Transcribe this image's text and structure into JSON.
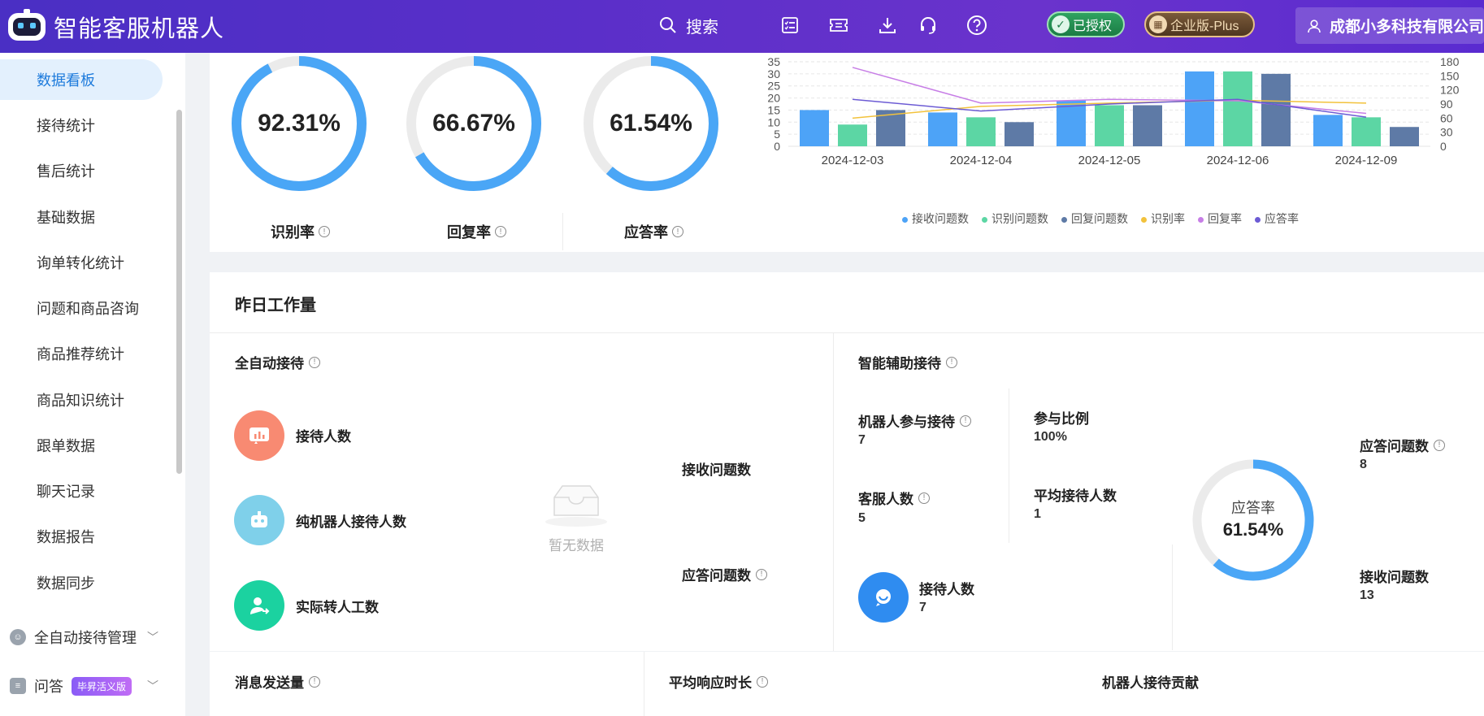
{
  "header": {
    "brand": "智能客服机器人",
    "search_label": "搜索",
    "auth_badge": "已授权",
    "plan_badge": "企业版-Plus",
    "company": "成都小多科技有限公司",
    "icons": [
      "checklist-icon",
      "ticket-icon",
      "download-icon",
      "headset-icon",
      "help-icon"
    ]
  },
  "sidebar": {
    "items": [
      {
        "label": "数据看板",
        "active": true
      },
      {
        "label": "接待统计"
      },
      {
        "label": "售后统计"
      },
      {
        "label": "基础数据"
      },
      {
        "label": "询单转化统计"
      },
      {
        "label": "问题和商品咨询"
      },
      {
        "label": "商品推荐统计"
      },
      {
        "label": "商品知识统计"
      },
      {
        "label": "跟单数据"
      },
      {
        "label": "聊天记录"
      },
      {
        "label": "数据报告"
      },
      {
        "label": "数据同步"
      }
    ],
    "groups": [
      {
        "label": "全自动接待管理"
      },
      {
        "label": "问答",
        "tag": "毕昇活义版"
      }
    ]
  },
  "rates": [
    {
      "value": "92.31%",
      "label": "识别率",
      "fraction": 0.9231
    },
    {
      "value": "66.67%",
      "label": "回复率",
      "fraction": 0.6667
    },
    {
      "value": "61.54%",
      "label": "应答率",
      "fraction": 0.6154
    }
  ],
  "chart_data": {
    "type": "bar",
    "categories": [
      "2024-12-03",
      "2024-12-04",
      "2024-12-05",
      "2024-12-06",
      "2024-12-09"
    ],
    "ylim": [
      0,
      35
    ],
    "yticks": [
      0,
      5,
      10,
      15,
      20,
      25,
      30,
      35
    ],
    "y2lim": [
      0,
      180
    ],
    "y2ticks": [
      0,
      30,
      60,
      90,
      120,
      150,
      180
    ],
    "series": [
      {
        "name": "接收问题数",
        "kind": "bar",
        "color": "#4da3f7",
        "values": [
          15,
          14,
          19,
          31,
          13
        ]
      },
      {
        "name": "识别问题数",
        "kind": "bar",
        "color": "#5cd6a4",
        "values": [
          9,
          12,
          17,
          31,
          12
        ]
      },
      {
        "name": "回复问题数",
        "kind": "bar",
        "color": "#5e7aa6",
        "values": [
          15,
          10,
          17,
          30,
          8
        ]
      },
      {
        "name": "识别率",
        "kind": "line",
        "color": "#f2c23c",
        "values": [
          60,
          85,
          92,
          98,
          92
        ]
      },
      {
        "name": "回复率",
        "kind": "line",
        "color": "#c77ee6",
        "values": [
          168,
          92,
          100,
          97,
          70
        ]
      },
      {
        "name": "应答率",
        "kind": "line",
        "color": "#6c5bd4",
        "values": [
          100,
          75,
          90,
          100,
          62
        ]
      }
    ],
    "legend_position": "bottom",
    "grid": true
  },
  "workload": {
    "title": "昨日工作量",
    "auto": {
      "title": "全自动接待",
      "items": [
        "接待人数",
        "纯机器人接待人数",
        "实际转人工数"
      ],
      "side_labels": [
        "接收问题数",
        "应答问题数"
      ],
      "empty_text": "暂无数据"
    },
    "assist": {
      "title": "智能辅助接待",
      "robot_participate_label": "机器人参与接待",
      "robot_participate_value": "7",
      "ratio_label": "参与比例",
      "ratio_value": "100%",
      "agents_label": "客服人数",
      "agents_value": "5",
      "avg_label": "平均接待人数",
      "avg_value": "1",
      "reception_label": "接待人数",
      "reception_value": "7",
      "answer_rate_label": "应答率",
      "answer_rate_value": "61.54%",
      "answer_rate_fraction": 0.6154,
      "answered_label": "应答问题数",
      "answered_value": "8",
      "received_label": "接收问题数",
      "received_value": "13"
    }
  },
  "bottom": {
    "msg_sent": "消息发送量",
    "avg_response": "平均响应时长",
    "robot_contrib": "机器人接待贡献"
  }
}
